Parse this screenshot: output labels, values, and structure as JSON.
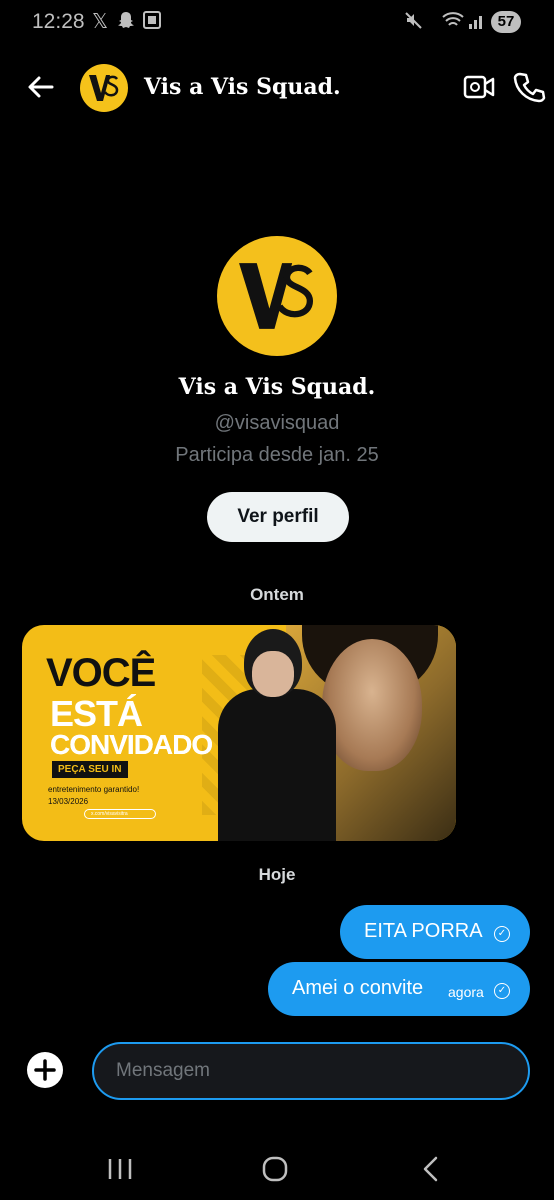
{
  "status_bar": {
    "time": "12:28",
    "icons": [
      "x-icon",
      "snapchat-icon",
      "screenshot-icon",
      "mute-icon",
      "wifi-icon",
      "signal-icon"
    ],
    "battery": "57"
  },
  "header": {
    "title": "Vis a Vis Squad.",
    "avatar_text": "VS",
    "accent": "#f5c21a"
  },
  "profile": {
    "name": "Vis a Vis Squad.",
    "handle": "@visavisquad",
    "joined": "Participa desde jan. 25",
    "button": "Ver perfil"
  },
  "days": {
    "yesterday": "Ontem",
    "today": "Hoje"
  },
  "invite_image": {
    "line1": "VOCÊ",
    "line2": "ESTÁ",
    "line3": "CONVIDADO",
    "cta": "PEÇA SEU IN",
    "info1": "entretenimento garantido!",
    "info2": "13/03/2026",
    "search": "x.com/visavisitra"
  },
  "messages": [
    {
      "text": "EITA PORRA",
      "time": ""
    },
    {
      "text": "Amei o convite",
      "time": "agora"
    }
  ],
  "composer": {
    "placeholder": "Mensagem"
  },
  "colors": {
    "bubble": "#1d9bf0",
    "background": "#000000",
    "button_bg": "#eff3f4"
  }
}
